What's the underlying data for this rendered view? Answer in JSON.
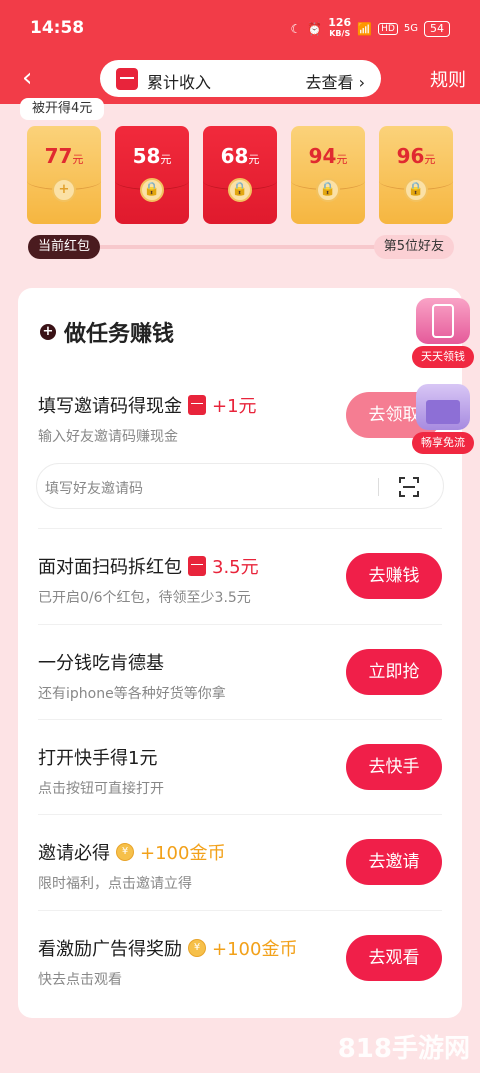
{
  "status": {
    "time": "14:58",
    "net_speed": "126",
    "net_unit": "KB/S",
    "hd": "HD",
    "signal": "5G",
    "battery": "54"
  },
  "header": {
    "back_icon": "‹",
    "income_label": "累计收入",
    "income_link": "去查看 ›",
    "rules": "规则"
  },
  "packets": {
    "bubble": "被开得4元",
    "items": [
      {
        "amount": "77",
        "unit": "元",
        "style": "gold",
        "icon": "plus"
      },
      {
        "amount": "58",
        "unit": "元",
        "style": "red",
        "icon": "lock"
      },
      {
        "amount": "68",
        "unit": "元",
        "style": "red",
        "icon": "lock"
      },
      {
        "amount": "94",
        "unit": "元",
        "style": "gold",
        "icon": "lock"
      },
      {
        "amount": "96",
        "unit": "元",
        "style": "gold",
        "icon": "lock"
      }
    ],
    "progress_left": "当前红包",
    "progress_right": "第5位好友"
  },
  "tasks_title": "做任务赚钱",
  "tasks": [
    {
      "name": "填写邀请码得现金",
      "reward": "+1元",
      "reward_type": "red",
      "desc": "输入好友邀请码赚现金",
      "button": "去领取"
    },
    {
      "name": "面对面扫码拆红包",
      "reward": "3.5元",
      "reward_type": "red",
      "desc": "已开启0/6个红包，待领至少3.5元",
      "button": "去赚钱"
    },
    {
      "name": "一分钱吃肯德基",
      "reward": "",
      "reward_type": "none",
      "desc": "还有iphone等各种好货等你拿",
      "button": "立即抢"
    },
    {
      "name": "打开快手得1元",
      "reward": "",
      "reward_type": "none",
      "desc": "点击按钮可直接打开",
      "button": "去快手"
    },
    {
      "name": "邀请必得",
      "reward": "+100金币",
      "reward_type": "gold",
      "desc": "限时福利，点击邀请立得",
      "button": "去邀请"
    },
    {
      "name": "看激励广告得奖励",
      "reward": "+100金币",
      "reward_type": "gold",
      "desc": "快去点击观看",
      "button": "去观看"
    }
  ],
  "code_input": {
    "placeholder": "填写好友邀请码"
  },
  "floating": {
    "daily": "天天领钱",
    "free_flow": "畅享免流"
  },
  "watermark": "818手游网"
}
